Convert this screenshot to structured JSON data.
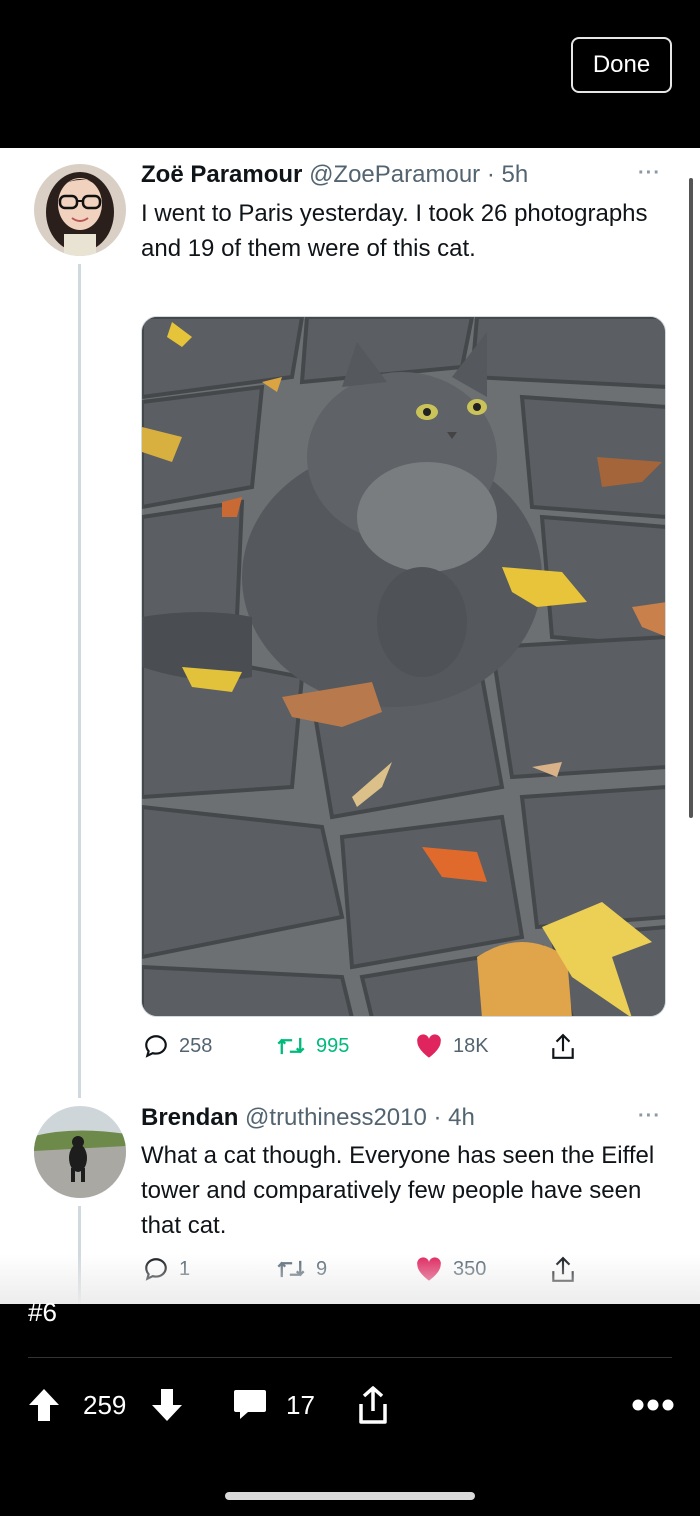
{
  "viewer": {
    "done_label": "Done"
  },
  "tweets": [
    {
      "name": "Zoë Paramour",
      "handle": "@ZoeParamour",
      "time": "5h",
      "text": "I went to Paris yesterday. I took 26 photographs and 19 of them were of this cat.",
      "replies": "258",
      "retweets": "995",
      "likes": "18K"
    },
    {
      "name": "Brendan",
      "handle": "@truthiness2010",
      "time": "4h",
      "text": "What a cat though. Everyone has seen the Eiffel tower and comparatively few people have seen that cat.",
      "replies": "1",
      "retweets": "9",
      "likes": "350"
    }
  ],
  "post": {
    "number": "#6",
    "upvotes": "259",
    "comments": "17"
  },
  "colors": {
    "like": "#e0245e",
    "retweet": "#00ba7c",
    "muted": "#536471"
  }
}
